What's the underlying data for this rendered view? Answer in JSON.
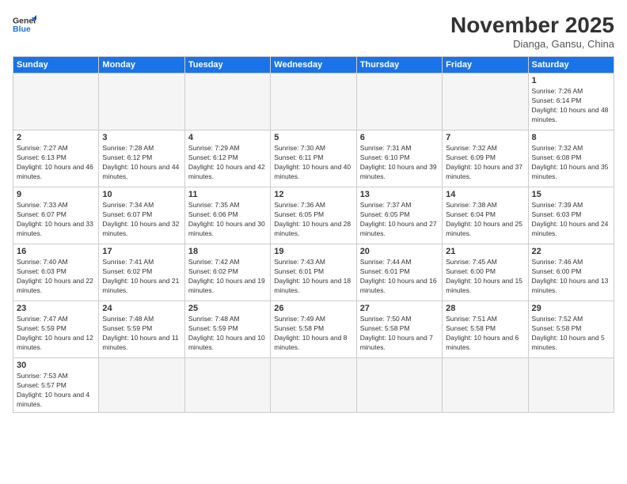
{
  "logo": {
    "line1": "General",
    "line2": "Blue"
  },
  "header": {
    "title": "November 2025",
    "subtitle": "Dianga, Gansu, China"
  },
  "weekdays": [
    "Sunday",
    "Monday",
    "Tuesday",
    "Wednesday",
    "Thursday",
    "Friday",
    "Saturday"
  ],
  "weeks": [
    [
      {
        "day": "",
        "info": ""
      },
      {
        "day": "",
        "info": ""
      },
      {
        "day": "",
        "info": ""
      },
      {
        "day": "",
        "info": ""
      },
      {
        "day": "",
        "info": ""
      },
      {
        "day": "",
        "info": ""
      },
      {
        "day": "1",
        "info": "Sunrise: 7:26 AM\nSunset: 6:14 PM\nDaylight: 10 hours and 48 minutes."
      }
    ],
    [
      {
        "day": "2",
        "info": "Sunrise: 7:27 AM\nSunset: 6:13 PM\nDaylight: 10 hours and 46 minutes."
      },
      {
        "day": "3",
        "info": "Sunrise: 7:28 AM\nSunset: 6:12 PM\nDaylight: 10 hours and 44 minutes."
      },
      {
        "day": "4",
        "info": "Sunrise: 7:29 AM\nSunset: 6:12 PM\nDaylight: 10 hours and 42 minutes."
      },
      {
        "day": "5",
        "info": "Sunrise: 7:30 AM\nSunset: 6:11 PM\nDaylight: 10 hours and 40 minutes."
      },
      {
        "day": "6",
        "info": "Sunrise: 7:31 AM\nSunset: 6:10 PM\nDaylight: 10 hours and 39 minutes."
      },
      {
        "day": "7",
        "info": "Sunrise: 7:32 AM\nSunset: 6:09 PM\nDaylight: 10 hours and 37 minutes."
      },
      {
        "day": "8",
        "info": "Sunrise: 7:32 AM\nSunset: 6:08 PM\nDaylight: 10 hours and 35 minutes."
      }
    ],
    [
      {
        "day": "9",
        "info": "Sunrise: 7:33 AM\nSunset: 6:07 PM\nDaylight: 10 hours and 33 minutes."
      },
      {
        "day": "10",
        "info": "Sunrise: 7:34 AM\nSunset: 6:07 PM\nDaylight: 10 hours and 32 minutes."
      },
      {
        "day": "11",
        "info": "Sunrise: 7:35 AM\nSunset: 6:06 PM\nDaylight: 10 hours and 30 minutes."
      },
      {
        "day": "12",
        "info": "Sunrise: 7:36 AM\nSunset: 6:05 PM\nDaylight: 10 hours and 28 minutes."
      },
      {
        "day": "13",
        "info": "Sunrise: 7:37 AM\nSunset: 6:05 PM\nDaylight: 10 hours and 27 minutes."
      },
      {
        "day": "14",
        "info": "Sunrise: 7:38 AM\nSunset: 6:04 PM\nDaylight: 10 hours and 25 minutes."
      },
      {
        "day": "15",
        "info": "Sunrise: 7:39 AM\nSunset: 6:03 PM\nDaylight: 10 hours and 24 minutes."
      }
    ],
    [
      {
        "day": "16",
        "info": "Sunrise: 7:40 AM\nSunset: 6:03 PM\nDaylight: 10 hours and 22 minutes."
      },
      {
        "day": "17",
        "info": "Sunrise: 7:41 AM\nSunset: 6:02 PM\nDaylight: 10 hours and 21 minutes."
      },
      {
        "day": "18",
        "info": "Sunrise: 7:42 AM\nSunset: 6:02 PM\nDaylight: 10 hours and 19 minutes."
      },
      {
        "day": "19",
        "info": "Sunrise: 7:43 AM\nSunset: 6:01 PM\nDaylight: 10 hours and 18 minutes."
      },
      {
        "day": "20",
        "info": "Sunrise: 7:44 AM\nSunset: 6:01 PM\nDaylight: 10 hours and 16 minutes."
      },
      {
        "day": "21",
        "info": "Sunrise: 7:45 AM\nSunset: 6:00 PM\nDaylight: 10 hours and 15 minutes."
      },
      {
        "day": "22",
        "info": "Sunrise: 7:46 AM\nSunset: 6:00 PM\nDaylight: 10 hours and 13 minutes."
      }
    ],
    [
      {
        "day": "23",
        "info": "Sunrise: 7:47 AM\nSunset: 5:59 PM\nDaylight: 10 hours and 12 minutes."
      },
      {
        "day": "24",
        "info": "Sunrise: 7:48 AM\nSunset: 5:59 PM\nDaylight: 10 hours and 11 minutes."
      },
      {
        "day": "25",
        "info": "Sunrise: 7:48 AM\nSunset: 5:59 PM\nDaylight: 10 hours and 10 minutes."
      },
      {
        "day": "26",
        "info": "Sunrise: 7:49 AM\nSunset: 5:58 PM\nDaylight: 10 hours and 8 minutes."
      },
      {
        "day": "27",
        "info": "Sunrise: 7:50 AM\nSunset: 5:58 PM\nDaylight: 10 hours and 7 minutes."
      },
      {
        "day": "28",
        "info": "Sunrise: 7:51 AM\nSunset: 5:58 PM\nDaylight: 10 hours and 6 minutes."
      },
      {
        "day": "29",
        "info": "Sunrise: 7:52 AM\nSunset: 5:58 PM\nDaylight: 10 hours and 5 minutes."
      }
    ],
    [
      {
        "day": "30",
        "info": "Sunrise: 7:53 AM\nSunset: 5:57 PM\nDaylight: 10 hours and 4 minutes."
      },
      {
        "day": "",
        "info": ""
      },
      {
        "day": "",
        "info": ""
      },
      {
        "day": "",
        "info": ""
      },
      {
        "day": "",
        "info": ""
      },
      {
        "day": "",
        "info": ""
      },
      {
        "day": "",
        "info": ""
      }
    ]
  ]
}
